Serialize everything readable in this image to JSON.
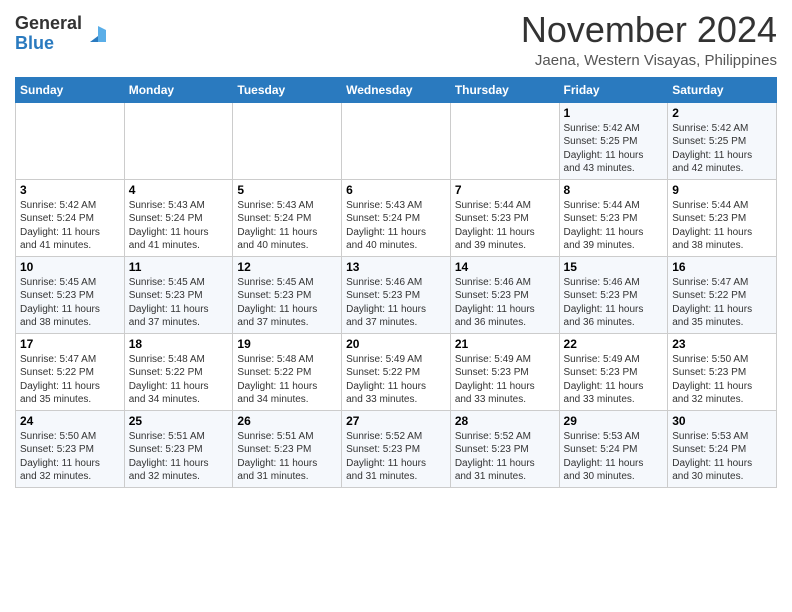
{
  "header": {
    "logo_general": "General",
    "logo_blue": "Blue",
    "month_title": "November 2024",
    "location": "Jaena, Western Visayas, Philippines"
  },
  "days_of_week": [
    "Sunday",
    "Monday",
    "Tuesday",
    "Wednesday",
    "Thursday",
    "Friday",
    "Saturday"
  ],
  "weeks": [
    [
      {
        "day": "",
        "info": ""
      },
      {
        "day": "",
        "info": ""
      },
      {
        "day": "",
        "info": ""
      },
      {
        "day": "",
        "info": ""
      },
      {
        "day": "",
        "info": ""
      },
      {
        "day": "1",
        "info": "Sunrise: 5:42 AM\nSunset: 5:25 PM\nDaylight: 11 hours\nand 43 minutes."
      },
      {
        "day": "2",
        "info": "Sunrise: 5:42 AM\nSunset: 5:25 PM\nDaylight: 11 hours\nand 42 minutes."
      }
    ],
    [
      {
        "day": "3",
        "info": "Sunrise: 5:42 AM\nSunset: 5:24 PM\nDaylight: 11 hours\nand 41 minutes."
      },
      {
        "day": "4",
        "info": "Sunrise: 5:43 AM\nSunset: 5:24 PM\nDaylight: 11 hours\nand 41 minutes."
      },
      {
        "day": "5",
        "info": "Sunrise: 5:43 AM\nSunset: 5:24 PM\nDaylight: 11 hours\nand 40 minutes."
      },
      {
        "day": "6",
        "info": "Sunrise: 5:43 AM\nSunset: 5:24 PM\nDaylight: 11 hours\nand 40 minutes."
      },
      {
        "day": "7",
        "info": "Sunrise: 5:44 AM\nSunset: 5:23 PM\nDaylight: 11 hours\nand 39 minutes."
      },
      {
        "day": "8",
        "info": "Sunrise: 5:44 AM\nSunset: 5:23 PM\nDaylight: 11 hours\nand 39 minutes."
      },
      {
        "day": "9",
        "info": "Sunrise: 5:44 AM\nSunset: 5:23 PM\nDaylight: 11 hours\nand 38 minutes."
      }
    ],
    [
      {
        "day": "10",
        "info": "Sunrise: 5:45 AM\nSunset: 5:23 PM\nDaylight: 11 hours\nand 38 minutes."
      },
      {
        "day": "11",
        "info": "Sunrise: 5:45 AM\nSunset: 5:23 PM\nDaylight: 11 hours\nand 37 minutes."
      },
      {
        "day": "12",
        "info": "Sunrise: 5:45 AM\nSunset: 5:23 PM\nDaylight: 11 hours\nand 37 minutes."
      },
      {
        "day": "13",
        "info": "Sunrise: 5:46 AM\nSunset: 5:23 PM\nDaylight: 11 hours\nand 37 minutes."
      },
      {
        "day": "14",
        "info": "Sunrise: 5:46 AM\nSunset: 5:23 PM\nDaylight: 11 hours\nand 36 minutes."
      },
      {
        "day": "15",
        "info": "Sunrise: 5:46 AM\nSunset: 5:23 PM\nDaylight: 11 hours\nand 36 minutes."
      },
      {
        "day": "16",
        "info": "Sunrise: 5:47 AM\nSunset: 5:22 PM\nDaylight: 11 hours\nand 35 minutes."
      }
    ],
    [
      {
        "day": "17",
        "info": "Sunrise: 5:47 AM\nSunset: 5:22 PM\nDaylight: 11 hours\nand 35 minutes."
      },
      {
        "day": "18",
        "info": "Sunrise: 5:48 AM\nSunset: 5:22 PM\nDaylight: 11 hours\nand 34 minutes."
      },
      {
        "day": "19",
        "info": "Sunrise: 5:48 AM\nSunset: 5:22 PM\nDaylight: 11 hours\nand 34 minutes."
      },
      {
        "day": "20",
        "info": "Sunrise: 5:49 AM\nSunset: 5:22 PM\nDaylight: 11 hours\nand 33 minutes."
      },
      {
        "day": "21",
        "info": "Sunrise: 5:49 AM\nSunset: 5:23 PM\nDaylight: 11 hours\nand 33 minutes."
      },
      {
        "day": "22",
        "info": "Sunrise: 5:49 AM\nSunset: 5:23 PM\nDaylight: 11 hours\nand 33 minutes."
      },
      {
        "day": "23",
        "info": "Sunrise: 5:50 AM\nSunset: 5:23 PM\nDaylight: 11 hours\nand 32 minutes."
      }
    ],
    [
      {
        "day": "24",
        "info": "Sunrise: 5:50 AM\nSunset: 5:23 PM\nDaylight: 11 hours\nand 32 minutes."
      },
      {
        "day": "25",
        "info": "Sunrise: 5:51 AM\nSunset: 5:23 PM\nDaylight: 11 hours\nand 32 minutes."
      },
      {
        "day": "26",
        "info": "Sunrise: 5:51 AM\nSunset: 5:23 PM\nDaylight: 11 hours\nand 31 minutes."
      },
      {
        "day": "27",
        "info": "Sunrise: 5:52 AM\nSunset: 5:23 PM\nDaylight: 11 hours\nand 31 minutes."
      },
      {
        "day": "28",
        "info": "Sunrise: 5:52 AM\nSunset: 5:23 PM\nDaylight: 11 hours\nand 31 minutes."
      },
      {
        "day": "29",
        "info": "Sunrise: 5:53 AM\nSunset: 5:24 PM\nDaylight: 11 hours\nand 30 minutes."
      },
      {
        "day": "30",
        "info": "Sunrise: 5:53 AM\nSunset: 5:24 PM\nDaylight: 11 hours\nand 30 minutes."
      }
    ]
  ]
}
